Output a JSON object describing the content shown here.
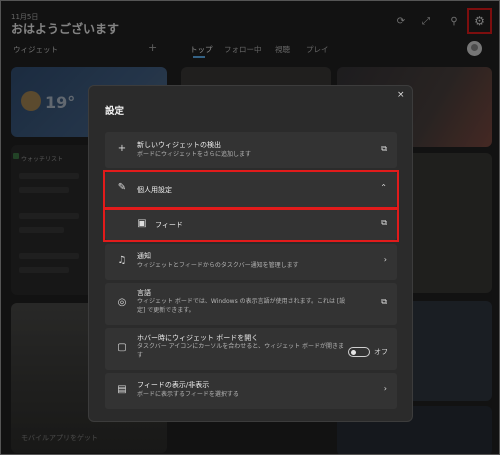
{
  "header": {
    "date": "11月5日",
    "greeting": "おはようございます",
    "icons": [
      "refresh-icon",
      "expand-icon",
      "pin-icon",
      "settings-icon"
    ]
  },
  "left_panel": {
    "widgets_label": "ウィジェット",
    "add_label": "+",
    "weather_temp": "19°",
    "stock_head": "ウォッチリスト",
    "promo_text": "モバイルアプリをゲット"
  },
  "tabs": [
    {
      "label": "トップ",
      "active": true
    },
    {
      "label": "フォロー中",
      "active": false
    },
    {
      "label": "視聴",
      "active": false
    },
    {
      "label": "プレイ",
      "active": false
    }
  ],
  "modal": {
    "title": "設定",
    "close_label": "×",
    "items": [
      {
        "icon": "plus-icon",
        "title": "新しいウィジェットの検出",
        "desc": "ボードにウィジェットをさらに追加します",
        "trail": "external-link-icon"
      },
      {
        "icon": "pencil-icon",
        "title": "個人用設定",
        "desc": "",
        "trail": "chevron-up-icon"
      },
      {
        "icon": "feed-icon",
        "title": "フィード",
        "desc": "",
        "trail": "external-link-icon"
      },
      {
        "icon": "bell-icon",
        "title": "通知",
        "desc": "ウィジェットとフィードからのタスクバー通知を管理します",
        "trail": "chevron-right-icon"
      },
      {
        "icon": "globe-icon",
        "title": "言語",
        "desc": "ウィジェット ボードでは、Windows の表示言語が使用されます。これは [設定] で更新できます。",
        "trail": "external-link-icon"
      },
      {
        "icon": "hover-icon",
        "title": "ホバー時にウィジェット ボードを開く",
        "desc": "タスクバー アイコンにカーソルを合わせると、ウィジェット ボードが開きます",
        "toggle_label": "オフ",
        "toggle_on": false
      },
      {
        "icon": "feed-visibility-icon",
        "title": "フィードの表示/非表示",
        "desc": "ボードに表示するフィードを選択する",
        "trail": "chevron-right-icon"
      }
    ]
  },
  "colors": {
    "highlight": "#e21b1b",
    "accent": "#5fb2f2",
    "modal_bg": "#2b2b2b",
    "row_bg": "#333333"
  }
}
